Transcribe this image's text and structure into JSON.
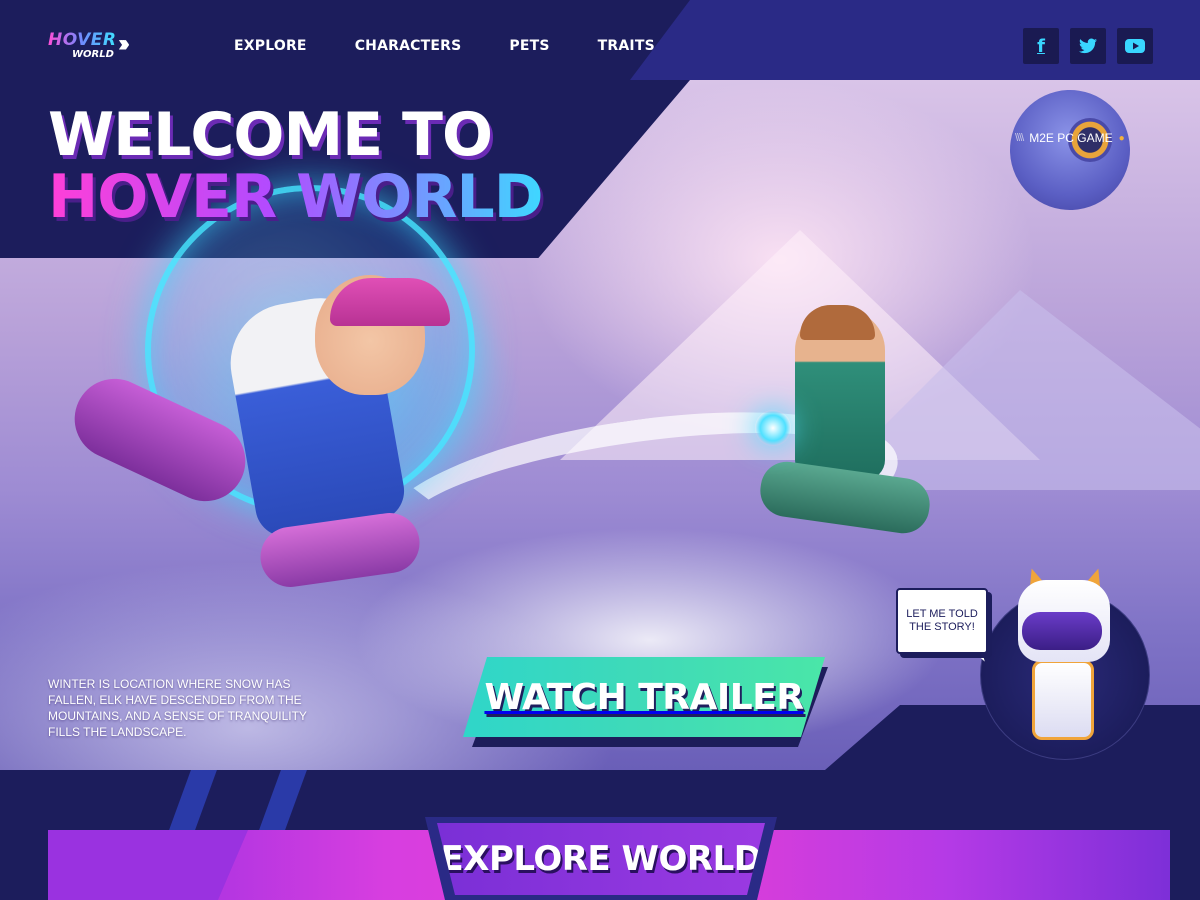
{
  "brand": {
    "logo_main": "HOVER",
    "logo_sub": "WORLD",
    "logo_chevrons": "›››"
  },
  "nav": {
    "items": [
      {
        "label": "EXPLORE"
      },
      {
        "label": "CHARACTERS"
      },
      {
        "label": "PETS"
      },
      {
        "label": "TRAITS"
      }
    ]
  },
  "social": {
    "facebook": {
      "icon": "facebook-icon",
      "glyph": "f"
    },
    "twitter": {
      "icon": "twitter-icon",
      "glyph": "🐦"
    },
    "youtube": {
      "icon": "youtube-icon",
      "glyph": "▶"
    }
  },
  "hero": {
    "title_line1": "WELCOME TO",
    "title_line2": "HOVER WORLD",
    "tagline": "M2E PC GAME",
    "description": "WINTER IS LOCATION WHERE SNOW HAS FALLEN, ELK HAVE DESCENDED FROM THE MOUNTAINS, AND A SENSE OF TRANQUILITY FILLS THE LANDSCAPE.",
    "cta_label": "WATCH TRAILER"
  },
  "mascot": {
    "speech": "LET ME TOLD THE STORY!"
  },
  "section": {
    "explore_title": "EXPLORE WORLD"
  },
  "colors": {
    "background": "#1c1d5c",
    "nav_panel": "#2a2a86",
    "accent_cyan": "#39d6ff",
    "accent_pink": "#ff3fd8",
    "cta_teal": "#3fdab8",
    "band_magenta": "#e53fd6"
  }
}
